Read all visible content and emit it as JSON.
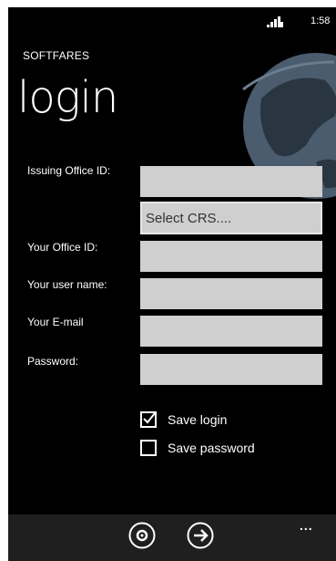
{
  "status_bar": {
    "time": "1:58",
    "signal_icon": "signal-strength-icon"
  },
  "header": {
    "app_name": "SOFTFARES",
    "page_title": "login"
  },
  "form": {
    "issuing_office_label": "Issuing Office ID:",
    "issuing_office_value": "",
    "crs_select_value": "Select CRS....",
    "your_office_label": "Your Office ID:",
    "your_office_value": "",
    "user_name_label": "Your user name:",
    "user_name_value": "",
    "email_label": "Your E-mail",
    "email_value": "",
    "password_label": "Password:",
    "password_value": ""
  },
  "options": {
    "save_login_label": "Save login",
    "save_login_checked": true,
    "save_password_label": "Save password",
    "save_password_checked": false
  },
  "app_bar": {
    "settings_icon": "settings-icon",
    "next_icon": "arrow-right-icon",
    "more_label": "..."
  },
  "colors": {
    "background": "#000000",
    "field_fill": "#cfcfcf",
    "app_bar": "#1f1f1f",
    "text": "#ffffff"
  }
}
